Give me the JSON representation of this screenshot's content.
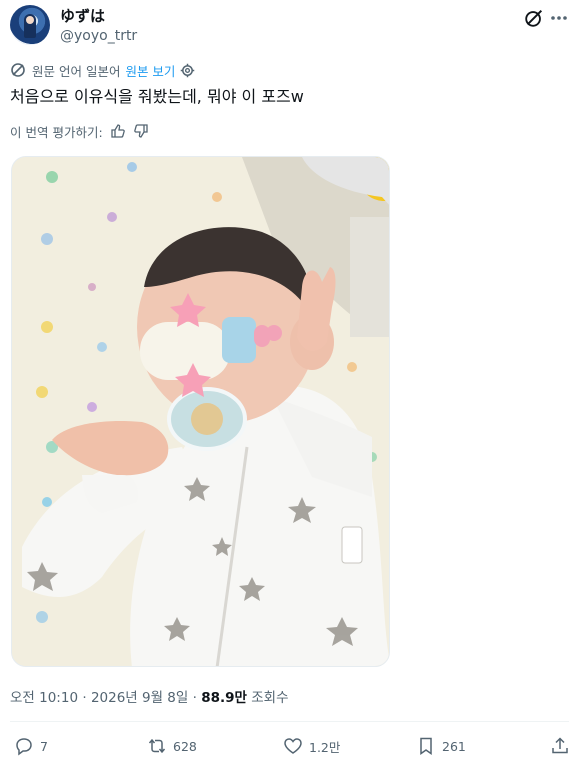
{
  "user": {
    "display_name": "ゆずは",
    "handle": "@yoyo_trtr"
  },
  "translation": {
    "source_language_label": "원문 언어 일본어",
    "view_original_label": "원본 보기",
    "rate_label": "이 번역 평가하기:"
  },
  "tweet": {
    "text": "처음으로 이유식을 줘봤는데, 뭐야 이 포즈w"
  },
  "meta": {
    "time": "오전 10:10",
    "date": "2026년 9월 8일",
    "separator": "·",
    "view_count": "88.9만",
    "view_label": "조회수"
  },
  "actions": {
    "replies": "7",
    "reposts": "628",
    "likes": "1.2만",
    "bookmarks": "261"
  },
  "colors": {
    "accent": "#1d9bf0",
    "secondary_text": "#536471",
    "primary_text": "#0f1419"
  },
  "icons": [
    "grok-icon",
    "more-icon",
    "translate-icon",
    "gear-icon",
    "thumb-up-icon",
    "thumb-down-icon",
    "reply-icon",
    "repost-icon",
    "like-icon",
    "bookmark-icon",
    "share-icon"
  ]
}
